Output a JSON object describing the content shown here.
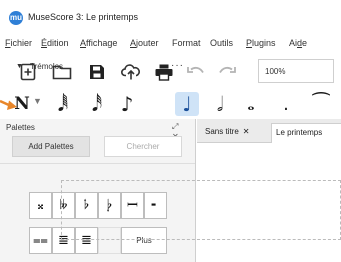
{
  "window": {
    "title": "MuseScore 3: Le printemps",
    "logo": "mu"
  },
  "menu": [
    {
      "pre": "",
      "ul": "F",
      "post": "ichier"
    },
    {
      "pre": "",
      "ul": "É",
      "post": "dition"
    },
    {
      "pre": "",
      "ul": "A",
      "post": "ffichage"
    },
    {
      "pre": "",
      "ul": "A",
      "post": "jouter"
    },
    {
      "pre": "",
      "ul": "",
      "post": "Format"
    },
    {
      "pre": "",
      "ul": "",
      "post": "Outils"
    },
    {
      "pre": "",
      "ul": "P",
      "post": "lugins"
    },
    {
      "pre": "Ai",
      "ul": "d",
      "post": "e"
    }
  ],
  "toolbar": {
    "icons": [
      "new-score-icon",
      "open-folder-icon",
      "save-icon",
      "cloud-upload-icon",
      "print-icon",
      "undo-icon",
      "redo-icon"
    ],
    "zoom": "100%"
  },
  "notes": {
    "mode_glyph": "N",
    "items": [
      {
        "name": "64th-note",
        "glyph": "𝅘𝅥𝅱",
        "active": false
      },
      {
        "name": "32nd-note",
        "glyph": "𝅘𝅥𝅰",
        "active": false
      },
      {
        "name": "eighth-note",
        "glyph": "♪",
        "active": false
      },
      {
        "name": "quarter-note",
        "glyph": "♩",
        "active": true
      },
      {
        "name": "half-note",
        "glyph": "𝅗𝅥",
        "active": false
      },
      {
        "name": "whole-note",
        "glyph": "𝅝",
        "active": false
      },
      {
        "name": "dot",
        "glyph": ".",
        "active": false
      },
      {
        "name": "tie",
        "glyph": "⁀",
        "active": false
      }
    ]
  },
  "palettes": {
    "header": "Palettes",
    "controls": "⤢ ✕",
    "add_label": "Add Palettes",
    "search_placeholder": "Chercher",
    "section": {
      "label": "Trémolos",
      "more": "···"
    },
    "cells": [
      "𝄪",
      "𝄫",
      "𝄬",
      "𝄭",
      "𝄩",
      "╸",
      "⩵",
      "≣",
      "≣"
    ],
    "more_label": "Plus"
  },
  "tabs": [
    {
      "label": "Sans titre",
      "close": "✕"
    },
    {
      "label": "Le printemps"
    }
  ],
  "colors": {
    "accent": "#2f7fd6",
    "active_note_bg": "#cfe3f7",
    "arrow": "#e8862a"
  }
}
